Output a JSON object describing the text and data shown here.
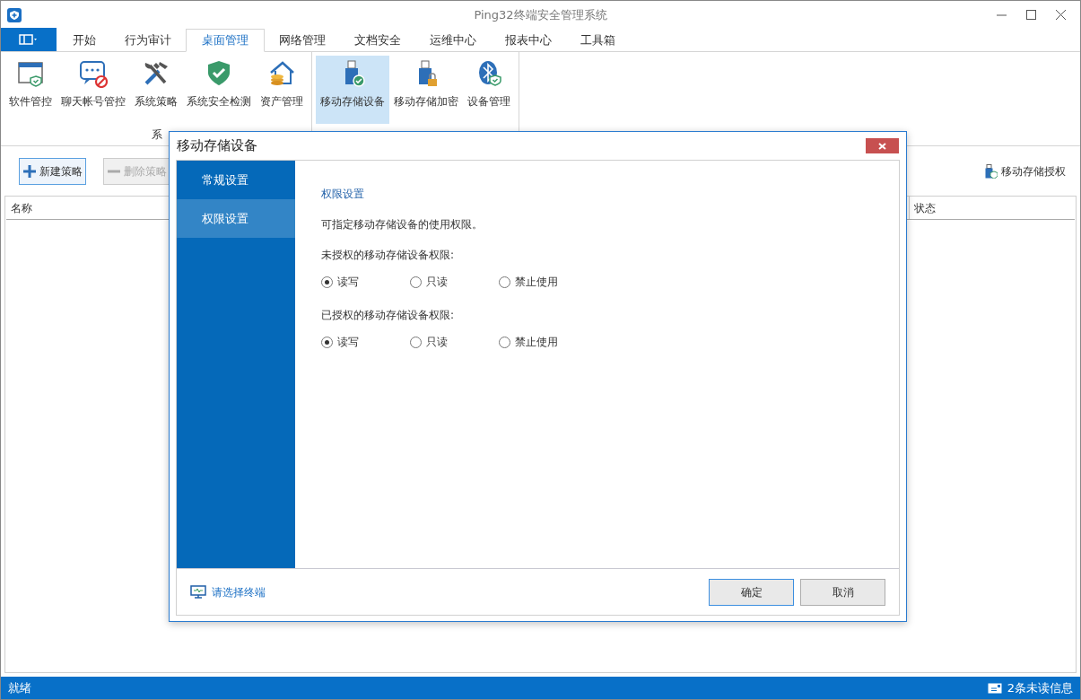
{
  "window": {
    "title": "Ping32终端安全管理系统"
  },
  "tabs": [
    {
      "label": "开始",
      "selected": false
    },
    {
      "label": "行为审计",
      "selected": false
    },
    {
      "label": "桌面管理",
      "selected": true
    },
    {
      "label": "网络管理",
      "selected": false
    },
    {
      "label": "文档安全",
      "selected": false
    },
    {
      "label": "运维中心",
      "selected": false
    },
    {
      "label": "报表中心",
      "selected": false
    },
    {
      "label": "工具箱",
      "selected": false
    }
  ],
  "ribbon": {
    "groups": [
      {
        "label": "系",
        "items": [
          {
            "label": "软件管控",
            "selected": false
          },
          {
            "label": "聊天帐号管控",
            "selected": false
          },
          {
            "label": "系统策略",
            "selected": false
          },
          {
            "label": "系统安全检测",
            "selected": false
          },
          {
            "label": "资产管理",
            "selected": false
          }
        ]
      },
      {
        "items": [
          {
            "label": "移动存储设备",
            "selected": true
          },
          {
            "label": "移动存储加密",
            "selected": false
          },
          {
            "label": "设备管理",
            "selected": false
          }
        ]
      }
    ]
  },
  "toolbar": {
    "buttons": [
      {
        "label": "新建策略",
        "disabled": false
      },
      {
        "label": "删除策略",
        "disabled": true
      }
    ],
    "right_link": "移动存储授权"
  },
  "table": {
    "columns": [
      "名称",
      "状态"
    ]
  },
  "dialog": {
    "title": "移动存储设备",
    "nav": [
      {
        "label": "常规设置",
        "selected": false
      },
      {
        "label": "权限设置",
        "selected": true
      }
    ],
    "heading": "权限设置",
    "description": "可指定移动存储设备的使用权限。",
    "groups": [
      {
        "label": "未授权的移动存储设备权限:",
        "options": [
          {
            "label": "读写",
            "selected": true
          },
          {
            "label": "只读",
            "selected": false
          },
          {
            "label": "禁止使用",
            "selected": false
          }
        ]
      },
      {
        "label": "已授权的移动存储设备权限:",
        "options": [
          {
            "label": "读写",
            "selected": true
          },
          {
            "label": "只读",
            "selected": false
          },
          {
            "label": "禁止使用",
            "selected": false
          }
        ]
      }
    ],
    "footer_link": "请选择终端",
    "buttons": [
      {
        "label": "确定",
        "primary": true
      },
      {
        "label": "取消",
        "primary": false
      }
    ]
  },
  "status_bar": {
    "left": "就绪",
    "right": "2条未读信息"
  }
}
